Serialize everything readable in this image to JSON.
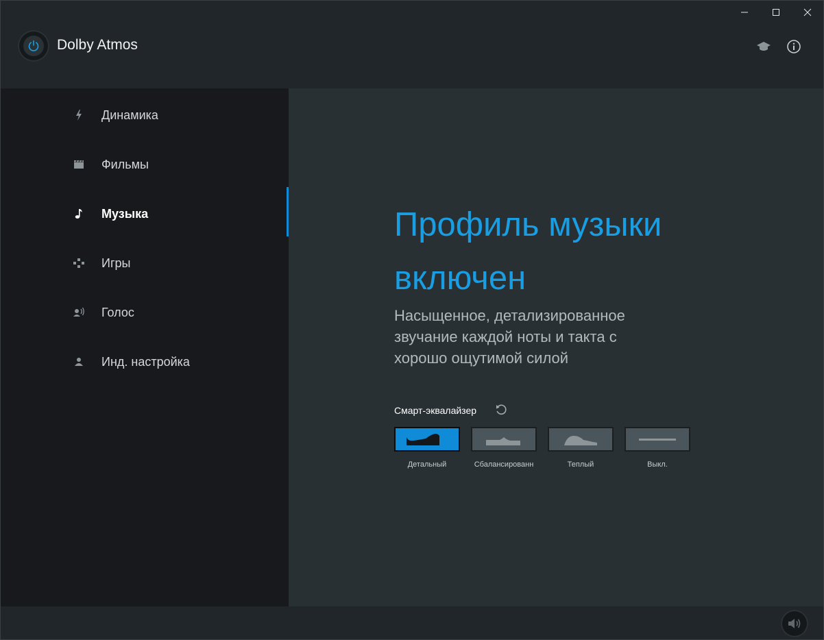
{
  "app": {
    "title": "Dolby Atmos",
    "accent_color": "#0f8bd8",
    "title_color": "#1a9ee3"
  },
  "window_controls": {
    "icons": [
      "minimize-icon",
      "maximize-icon",
      "close-icon"
    ]
  },
  "header_icons": [
    "graduation-cap-icon",
    "info-icon"
  ],
  "sidebar": {
    "items": [
      {
        "label": "Динамика",
        "icon": "lightning-icon",
        "active": false
      },
      {
        "label": "Фильмы",
        "icon": "clapperboard-icon",
        "active": false
      },
      {
        "label": "Музыка",
        "icon": "music-note-icon",
        "active": true
      },
      {
        "label": "Игры",
        "icon": "gamepad-icon",
        "active": false
      },
      {
        "label": "Голос",
        "icon": "voice-icon",
        "active": false
      },
      {
        "label": "Инд. настройка",
        "icon": "person-icon",
        "active": false
      }
    ]
  },
  "main": {
    "headline_line1": "Профиль музыки",
    "headline_line2": "включен",
    "description_line1": "Насыщенное, детализированное",
    "description_line2": "звучание каждой ноты и такта с",
    "description_line3": "хорошо ощутимой силой"
  },
  "equalizer": {
    "title": "Смарт-эквалайзер",
    "reset_icon": "reset-icon",
    "presets": [
      {
        "label": "Детальный",
        "active": true
      },
      {
        "label": "Сбалансированн",
        "active": false
      },
      {
        "label": "Теплый",
        "active": false
      },
      {
        "label": "Выкл.",
        "active": false
      }
    ]
  },
  "footer": {
    "volume_icon": "speaker-icon"
  }
}
